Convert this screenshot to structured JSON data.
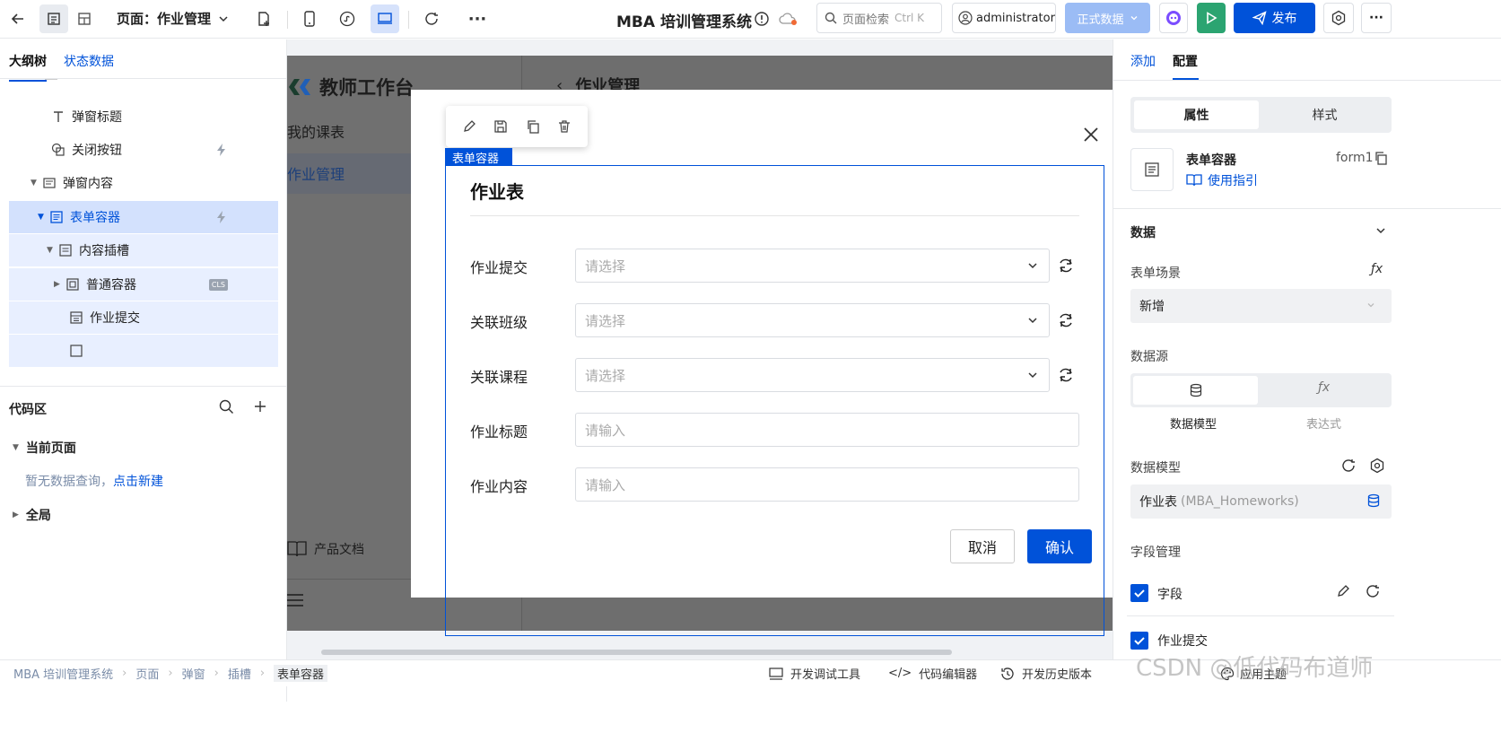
{
  "topbar": {
    "page_label": "页面：作业管理",
    "app_title": "MBA 培训管理系统",
    "search_placeholder": "页面检索",
    "search_shortcut": "Ctrl K",
    "user": "administrator",
    "env": "正式数据",
    "publish": "发布"
  },
  "left": {
    "tabs": [
      "大纲树",
      "状态数据"
    ],
    "tree": [
      {
        "label": "弹窗标题",
        "icon": "text-icon"
      },
      {
        "label": "关闭按钮",
        "icon": "close-button-icon"
      },
      {
        "label": "弹窗内容",
        "icon": "container-icon"
      },
      {
        "label": "表单容器",
        "icon": "form-icon"
      },
      {
        "label": "内容插槽",
        "icon": "slot-icon"
      },
      {
        "label": "普通容器",
        "icon": "box-icon",
        "badge": "CLS"
      },
      {
        "label": "作业提交",
        "icon": "select-field-icon"
      }
    ],
    "code_area": {
      "title": "代码区",
      "current_page": "当前页面",
      "empty_text": "暂无数据查询，",
      "create_link": "点击新建",
      "global": "全局"
    }
  },
  "canvas": {
    "app_logo_text": "教师工作台",
    "page_header": "作业管理",
    "nav": [
      "我的课表",
      "作业管理"
    ],
    "docs": "产品文档",
    "selected_label": "表单容器",
    "modal": {
      "form_title": "作业表",
      "fields": [
        {
          "label": "作业提交",
          "placeholder": "请选择",
          "type": "select"
        },
        {
          "label": "关联班级",
          "placeholder": "请选择",
          "type": "select"
        },
        {
          "label": "关联课程",
          "placeholder": "请选择",
          "type": "select"
        },
        {
          "label": "作业标题",
          "placeholder": "请输入",
          "type": "input"
        },
        {
          "label": "作业内容",
          "placeholder": "请输入",
          "type": "input"
        }
      ],
      "cancel": "取消",
      "confirm": "确认"
    }
  },
  "right": {
    "tabs": [
      "添加",
      "配置"
    ],
    "seg": [
      "属性",
      "样式"
    ],
    "component_name": "表单容器",
    "component_id": "form1",
    "guide_link": "使用指引",
    "data_section": "数据",
    "scene_label": "表单场景",
    "scene_value": "新增",
    "datasource_label": "数据源",
    "ds_options": [
      "数据模型",
      "表达式"
    ],
    "model_label": "数据模型",
    "model_value": "作业表",
    "model_code": "(MBA_Homeworks)",
    "field_mgmt": "字段管理",
    "field_header": "字段",
    "first_field": "作业提交"
  },
  "bottom": {
    "breadcrumb": [
      "MBA 培训管理系统",
      "页面",
      "弹窗",
      "插槽",
      "表单容器"
    ],
    "tools": [
      "开发调试工具",
      "代码编辑器",
      "开发历史版本"
    ],
    "theme": "应用主题",
    "watermark": "CSDN @低代码布道师"
  },
  "colors": {
    "primary": "#0052d9",
    "run": "#2ba471",
    "selection": "#d3e1fd"
  }
}
